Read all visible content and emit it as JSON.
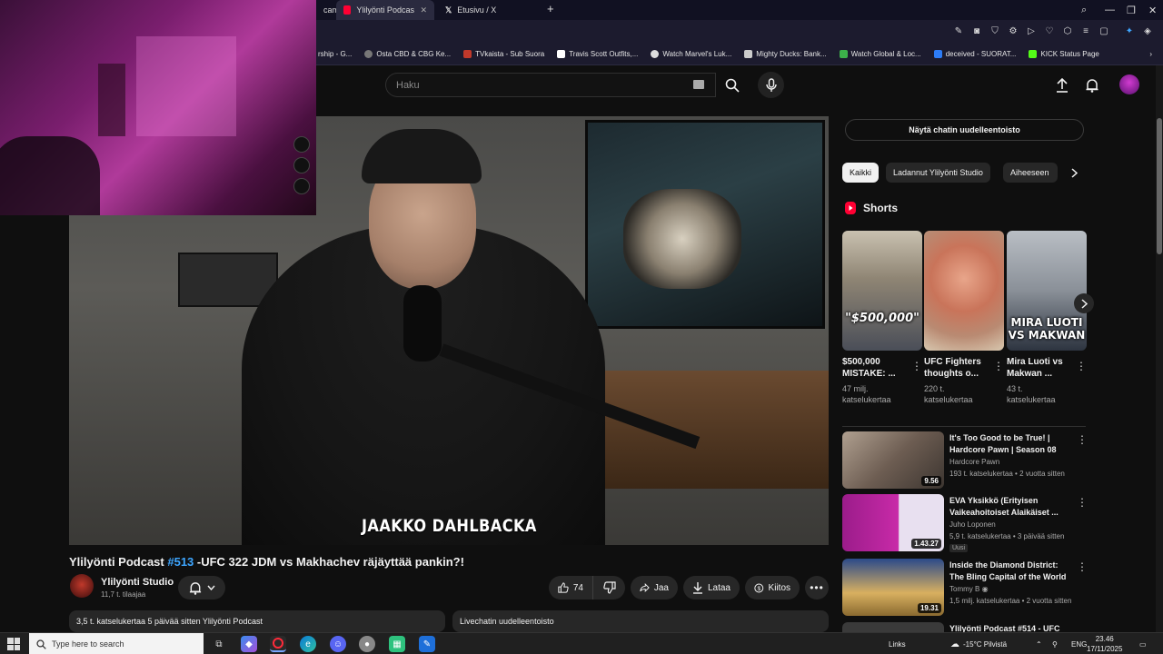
{
  "browser": {
    "tabs": [
      {
        "title": "cam"
      },
      {
        "title": "Ylilyönti Podcast #513"
      },
      {
        "title": "Etusivu / X"
      }
    ],
    "bookmarks": [
      {
        "label": "rship - G..."
      },
      {
        "label": "Osta CBD & CBG Ke..."
      },
      {
        "label": "TVkaista - Sub Suora"
      },
      {
        "label": "Travis Scott Outfits,..."
      },
      {
        "label": "Watch Marvel's Luk..."
      },
      {
        "label": "Mighty Ducks: Bank..."
      },
      {
        "label": "Watch Global & Loc..."
      },
      {
        "label": "deceived - SUORAT..."
      },
      {
        "label": "KICK Status Page"
      }
    ]
  },
  "header": {
    "search_placeholder": "Haku"
  },
  "video": {
    "lower_third": "JAAKKO DAHLBACKA",
    "title_prefix": "Ylilyönti Podcast ",
    "title_tag": "#513",
    "title_rest": " -UFC 322 JDM vs Makhachev räjäyttää pankin?!",
    "channel_name": "Ylilyönti Studio",
    "subscribers": "11,7 t. tilaajaa",
    "likes": "74",
    "share_label": "Jaa",
    "download_label": "Lataa",
    "thanks_label": "Kiitos",
    "description_meta": "3,5 t. katselukertaa  5 päivää sitten  ",
    "description_channel": "Ylilyönti Podcast",
    "chat_replay_label": "Livechatin uudelleentoisto"
  },
  "sidebar": {
    "chat_replay_button": "Näytä chatin uudelleentoisto",
    "chips": [
      "Kaikki",
      "Ladannut Ylilyönti Studio",
      "Aiheeseen"
    ],
    "shorts_heading": "Shorts",
    "shorts": [
      {
        "overlay": "\"$500,000\"",
        "title": "$500,000 MISTAKE: ...",
        "views": "47 milj. katselukertaa"
      },
      {
        "overlay": "",
        "title": "UFC Fighters thoughts o...",
        "views": "220 t. katselukertaa"
      },
      {
        "overlay": "MIRA LUOTI VS MAKWAN",
        "title": "Mira Luoti vs Makwan ...",
        "views": "43 t. katselukertaa"
      }
    ],
    "recommendations": [
      {
        "title": "It's Too Good to be True! | Hardcore Pawn | Season 08",
        "channel": "Hardcore Pawn",
        "meta": "193 t. katselukertaa • 2 vuotta sitten",
        "duration": "9.56",
        "badge": ""
      },
      {
        "title": "EVA Yksikkö (Erityisen Vaikeahoitoiset Alaikäiset ...",
        "channel": "Juho Loponen",
        "meta": "5,9 t. katselukertaa • 3 päivää sitten",
        "duration": "1.43.27",
        "badge": "Uusi"
      },
      {
        "title": "Inside the Diamond District: The Bling Capital of the World",
        "channel": "Tommy B",
        "meta": "1,5 milj. katselukertaa • 2 vuotta sitten",
        "duration": "19.31",
        "badge": ""
      },
      {
        "title": "Ylilyönti Podcast #514 - UFC ...",
        "channel": "",
        "meta": "",
        "duration": "",
        "badge": ""
      }
    ]
  },
  "taskbar": {
    "search_placeholder": "Type here to search",
    "links_label": "Links",
    "weather": "-15°C  Pilvistä",
    "language": "ENG",
    "time": "23.46",
    "date": "17/11/2025"
  },
  "colors": {
    "bg": "#0f0f0f",
    "accent_link": "#3ea6ff",
    "youtube_red": "#ff0033",
    "chip_active": "#f1f1f1"
  }
}
